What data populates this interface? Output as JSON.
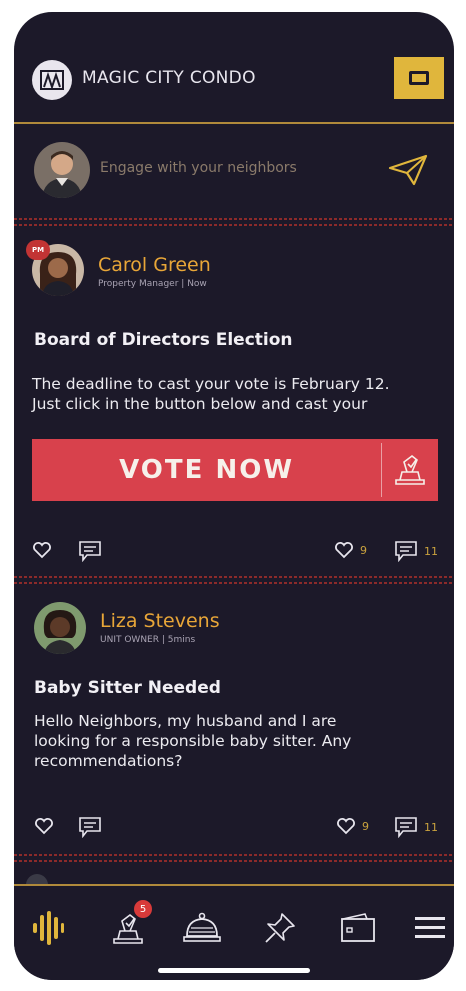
{
  "header": {
    "brand": "MAGIC CITY CONDO",
    "logo_icon": "building-logo-icon",
    "menu_icon": "panel-icon"
  },
  "composer": {
    "placeholder": "Engage with your neighbors",
    "send_icon": "paper-plane-icon"
  },
  "posts": [
    {
      "author": "Carol Green",
      "role": "Property Manager",
      "time": "Now",
      "badge": "PM",
      "title": "Board of Directors Election",
      "body_lines": [
        "The deadline to cast your vote is February 12.",
        "Just click in the button below and cast your"
      ],
      "cta_label": "VOTE NOW",
      "likes": "9",
      "comments": "11"
    },
    {
      "author": "Liza Stevens",
      "role": "UNIT OWNER",
      "time": "5mins",
      "title": "Baby Sitter Needed",
      "body_lines": [
        "Hello Neighbors, my husband and I are",
        "looking for a responsible baby sitter. Any",
        "recommendations?"
      ],
      "likes": "9",
      "comments": "11"
    }
  ],
  "tabbar": {
    "items": [
      {
        "name": "feed",
        "icon": "sound-wave-icon"
      },
      {
        "name": "vote",
        "icon": "ballot-icon",
        "badge": "5"
      },
      {
        "name": "services",
        "icon": "service-bell-icon"
      },
      {
        "name": "pinned",
        "icon": "pin-icon"
      },
      {
        "name": "wallet",
        "icon": "wallet-icon"
      },
      {
        "name": "menu",
        "icon": "hamburger-icon"
      }
    ]
  },
  "colors": {
    "background": "#1c1929",
    "accent_gold": "#e0b63c",
    "author_orange": "#e8a638",
    "vote_red": "#d8414c"
  }
}
